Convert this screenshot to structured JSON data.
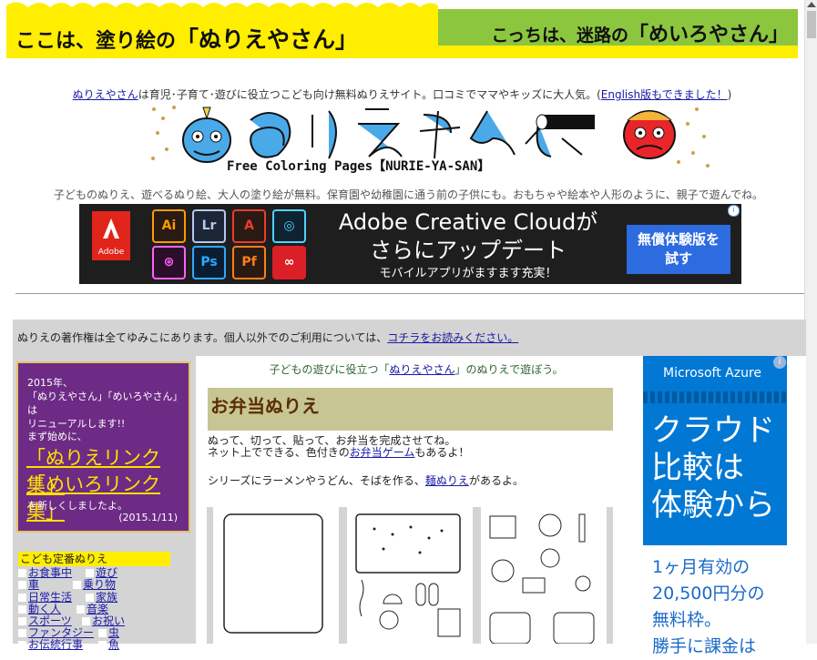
{
  "header": {
    "nurie_tab": {
      "prefix": "ここは、塗り絵の",
      "name": "「ぬりえやさん」"
    },
    "meiro_tab": {
      "prefix": "こっちは、迷路の",
      "name": "「めいろやさん」"
    }
  },
  "intro": {
    "site_link": "ぬりえやさん",
    "text": "は育児･子育て･遊びに役立つこども向け無料ぬりえサイト。口コミでママやキッズに大人気。(",
    "english_link": "English版もできました！",
    "close": ")"
  },
  "logo": {
    "subtitle": "Free Coloring Pages【NURIE-YA-SAN】"
  },
  "tagline": "子どものぬりえ、遊べるぬり絵、大人の塗り絵が無料。保育園や幼稚園に通う前の子供にも。おもちゃや絵本や人形のように、親子で遊んでね。",
  "ad_adobe": {
    "logo": "Adobe",
    "apps": [
      "Ai",
      "Lr",
      "A",
      "◎",
      "⊛",
      "Ps",
      "Pf",
      "∞"
    ],
    "headline_1": "Adobe Creative Cloudが",
    "headline_2": "さらにアップデート",
    "sub": "モバイルアプリがますます充実！",
    "cta_1": "無償体験版を",
    "cta_2": "試す",
    "info": "i"
  },
  "notice": {
    "text": "ぬりえの著作権は全てゆみこにあります。個人以外でのご利用については、",
    "link": "コチラをお読みください。"
  },
  "promo": {
    "line1": "2015年、",
    "line2": "「ぬりえやさん」「めいろやさん」は",
    "line3": "リニューアルします!!",
    "line4": "まず始めに、",
    "link1": "「ぬりえリンク集」",
    "link2": "「めいろリンク集」",
    "line5": "を新しくしましたよ。",
    "date": "(2015.1/11)"
  },
  "categories": {
    "heading": "こども定番ぬりえ",
    "left": [
      "お食事中",
      "車",
      "日常生活",
      "動く人",
      "スポーツ",
      "ファンタジー",
      "お伝統行事"
    ],
    "right": [
      "遊び",
      "乗り物",
      "家族",
      "音楽",
      "お祝い",
      "虫",
      "魚"
    ]
  },
  "main": {
    "lead_prefix": "子どもの遊びに役立つ「",
    "lead_link": "ぬりえやさん",
    "lead_suffix": "」のぬりえで遊ぼう。",
    "title": "お弁当ぬりえ",
    "desc_line1": "ぬって、切って、貼って、お弁当を完成させてね。",
    "desc_line2_prefix": "ネット上でできる、色付きの",
    "desc_line2_link": "お弁当ゲーム",
    "desc_line2_suffix": "もあるよ！",
    "series_prefix": "シリーズにラーメンやうどん、そばを作る、",
    "series_link": "麺ぬりえ",
    "series_suffix": "があるよ。"
  },
  "ad_azure": {
    "brand": "Microsoft Azure",
    "headline": [
      "クラウド",
      "比較は",
      "体験から"
    ],
    "body": [
      "1ヶ月有効の",
      "20,500円分の",
      "無料枠。",
      "勝手に課金は"
    ],
    "info": "i"
  },
  "colors": {
    "yellow": "#ffee00",
    "green": "#8cc63f",
    "purple": "#6d2b85",
    "azure": "#0078d4",
    "gray": "#d4d4d4",
    "olive": "#c7c594"
  }
}
